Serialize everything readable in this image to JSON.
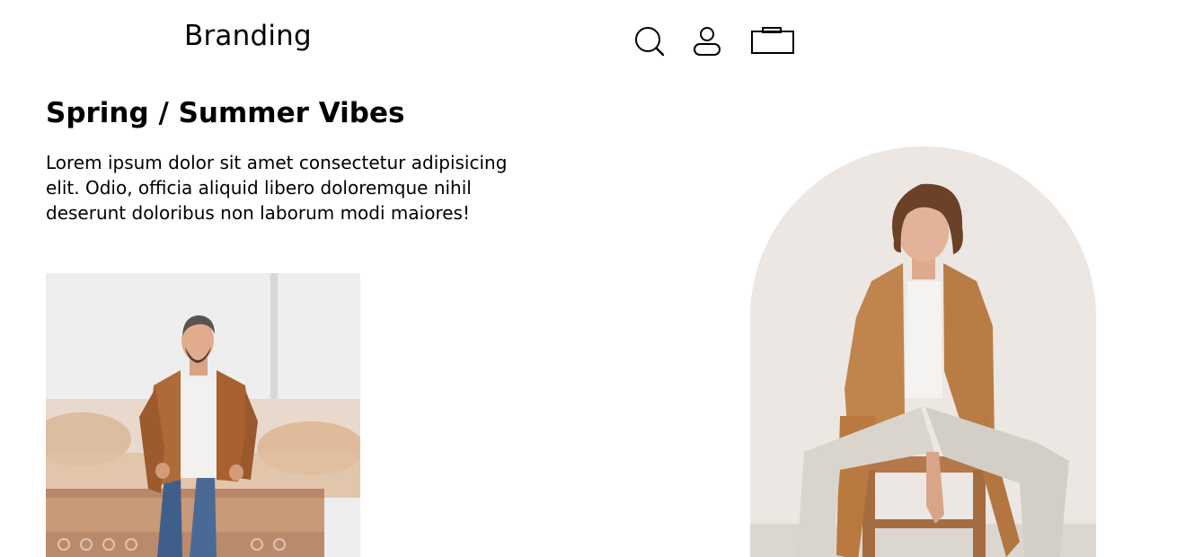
{
  "header": {
    "brand": "Branding",
    "icons": [
      "search-icon",
      "user-icon",
      "bag-icon"
    ]
  },
  "hero": {
    "title": "Spring / Summer Vibes",
    "description": "Lorem ipsum dolor sit amet consectetur adipisicing elit. Odio, officia aliquid libero doloremque nihil deserunt doloribus non laborum modi maiores!"
  },
  "images": {
    "left_photo": "man-in-leather-jacket-photo",
    "right_photo": "man-sitting-on-stool-photo"
  },
  "colors": {
    "text": "#000000",
    "background": "#ffffff",
    "jacket_left": "#b06a38",
    "jacket_right": "#c0844d",
    "wall_right": "#ece7e2"
  }
}
